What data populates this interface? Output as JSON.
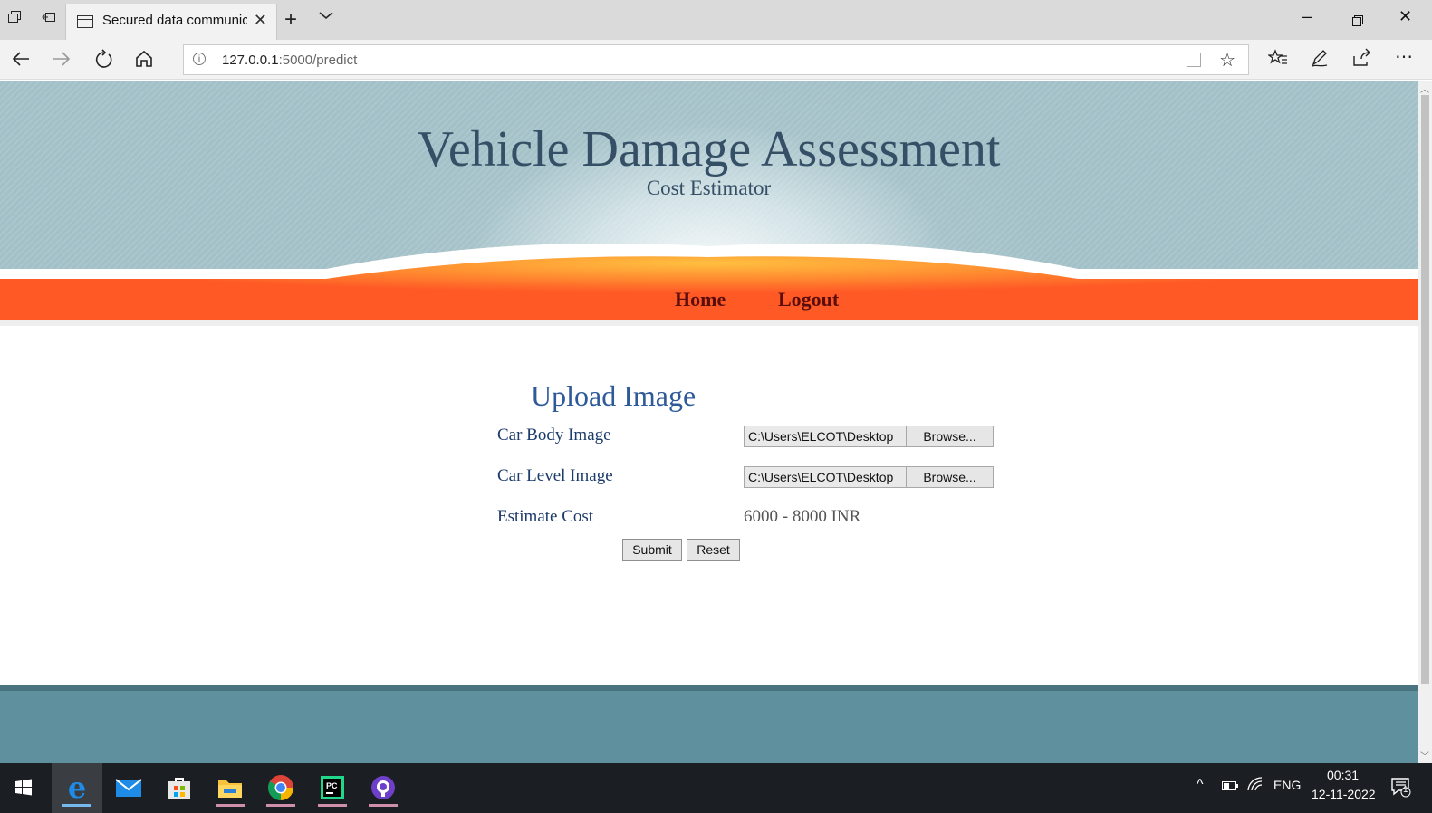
{
  "browser": {
    "tab_title": "Secured data communic",
    "url_host": "127.0.0.1",
    "url_path": ":5000/predict"
  },
  "site": {
    "title": "Vehicle Damage Assessment",
    "subtitle": "Cost Estimator",
    "nav": [
      {
        "label": "Home"
      },
      {
        "label": "Logout"
      }
    ]
  },
  "form": {
    "title": "Upload Image",
    "car_body_label": "Car Body Image",
    "car_body_value": "C:\\Users\\ELCOT\\Desktop",
    "car_level_label": "Car Level Image",
    "car_level_value": "C:\\Users\\ELCOT\\Desktop",
    "browse_label": "Browse...",
    "estimate_label": "Estimate Cost",
    "estimate_value": "6000 - 8000 INR",
    "submit_label": "Submit",
    "reset_label": "Reset"
  },
  "taskbar": {
    "lang": "ENG",
    "time": "00:31",
    "date": "12-11-2022",
    "notification_count": "1"
  },
  "colors": {
    "header_bg": "#a2c0c7",
    "title_color": "#355066",
    "menu_orange": "#ff5a26",
    "menu_text": "#5a0d0d",
    "footer_bg": "#5e909e"
  }
}
